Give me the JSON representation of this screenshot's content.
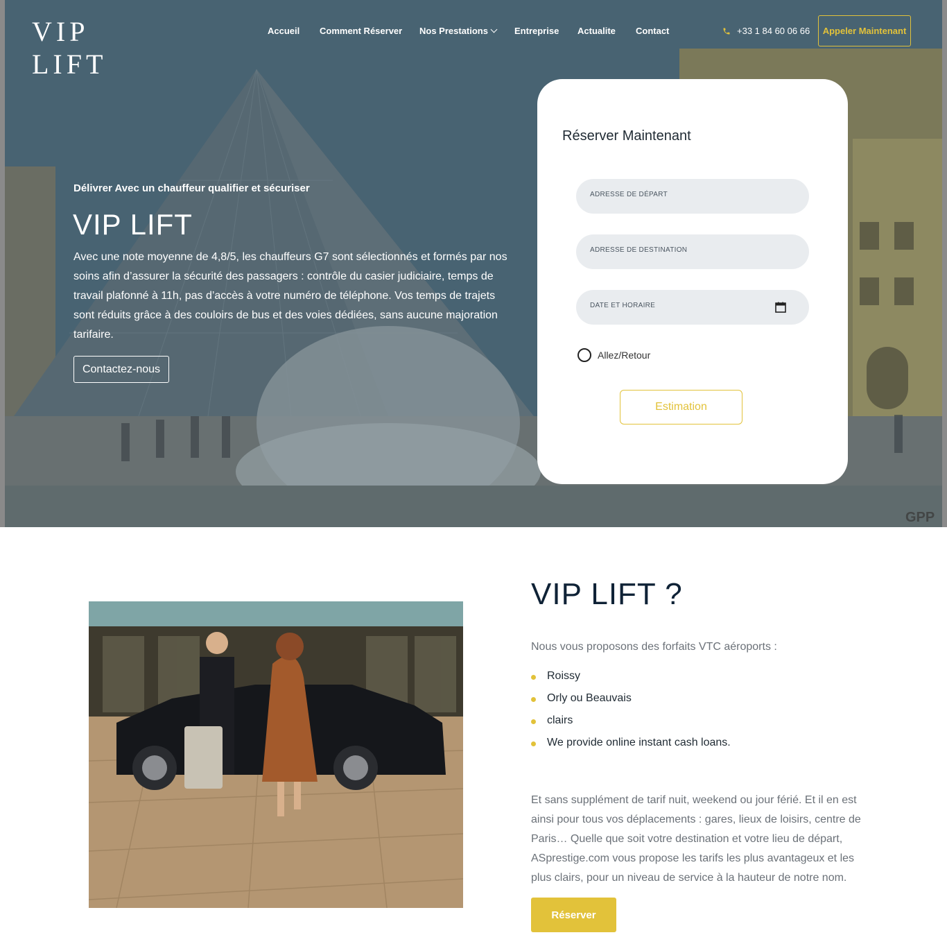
{
  "header": {
    "logo_text": "VIP LIFT",
    "nav": {
      "accueil": "Accueil",
      "comment_reserver": "Comment Réserver",
      "nos_prestations": "Nos Prestations",
      "entreprise": "Entreprise",
      "actualite": "Actualite",
      "contact": "Contact"
    },
    "phone": "+33 1 84 60 06 66",
    "call_button": "Appeler Maintenant"
  },
  "hero": {
    "subtitle": "Délivrer Avec un chauffeur qualifier et sécuriser",
    "title": "VIP LIFT",
    "paragraph": "Avec une note moyenne de 4,8/5, les chauffeurs G7 sont sélectionnés et formés par nos soins afin d’assurer la sécurité des passagers : contrôle du casier judiciaire, temps de travail plafonné à 11h, pas d’accès à votre numéro de téléphone. Vos temps de trajets sont réduits grâce à des couloirs de bus et des voies dédiées, sans aucune majoration tarifaire.",
    "contact_button": "Contactez-nous",
    "watermark": "GPP"
  },
  "booking": {
    "title": "Réserver Maintenant",
    "departure_placeholder": "ADRESSE DE DÉPART",
    "destination_placeholder": "ADRESSE DE DESTINATION",
    "datetime_placeholder": "DATE ET HORAIRE",
    "round_trip_label": "Allez/Retour",
    "estimate_button": "Estimation"
  },
  "about": {
    "title": "VIP LIFT ?",
    "intro": "Nous vous proposons des forfaits VTC aéroports :",
    "items": [
      "Roissy",
      "Orly ou Beauvais",
      "clairs",
      "We provide online instant cash loans."
    ],
    "paragraph": "Et sans supplément de tarif nuit, weekend ou jour férié. Et il en est ainsi pour tous vos déplacements : gares, lieux de loisirs, centre de Paris… Quelle que soit votre destination et votre lieu de départ, ASprestige.com vous propose les tarifs les plus avantageux et les plus clairs, pour un niveau de service à la hauteur de notre nom.",
    "reserve_button": "Réserver"
  },
  "colors": {
    "accent": "#e2c23a",
    "title_dark": "#0f2236",
    "muted_text": "#6b7178",
    "field_bg": "#e9ecef"
  }
}
